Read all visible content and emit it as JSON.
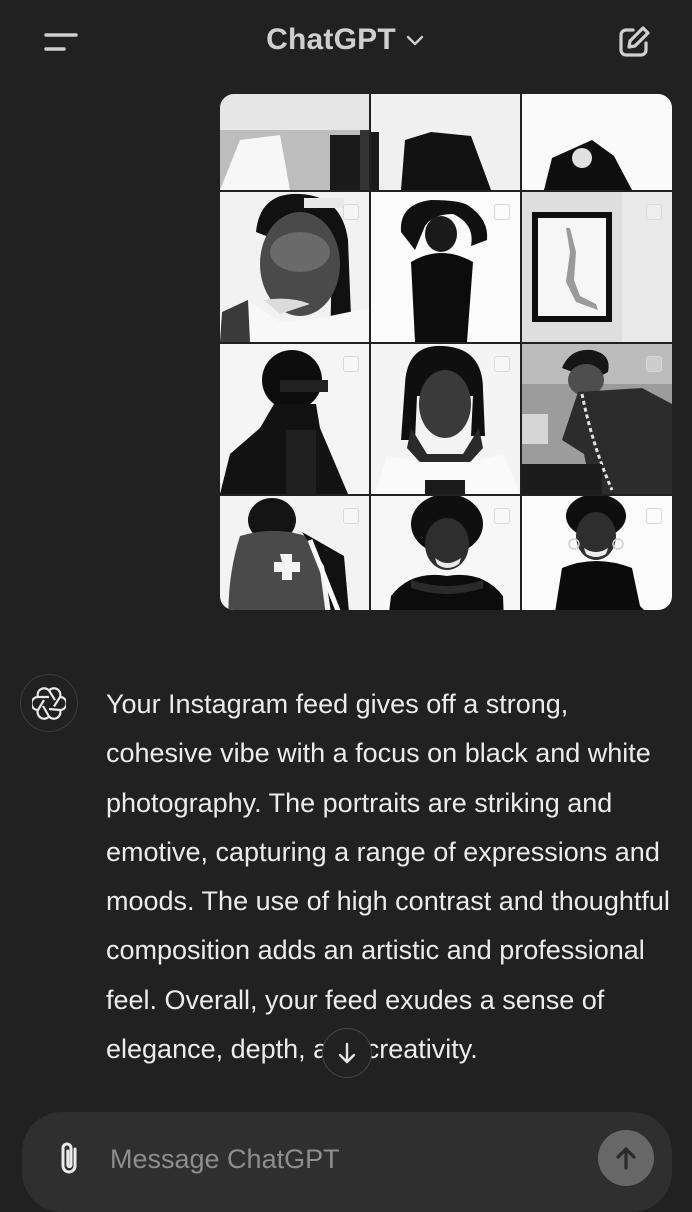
{
  "header": {
    "title": "ChatGPT",
    "menu_icon": "sidebar-menu-icon",
    "model_chevron_icon": "chevron-down-icon",
    "new_chat_icon": "new-chat-icon"
  },
  "image_attachment": {
    "style": "black-and-white Instagram grid screenshot",
    "columns": 3,
    "visible_rows": 5
  },
  "assistant_message": {
    "avatar_icon": "openai-logo-icon",
    "text": "Your Instagram feed gives off a strong, cohesive vibe with a focus on black and white photography. The portraits are striking and emotive, capturing a range of expressions and moods. The use of high contrast and thoughtful composition adds an artistic and professional feel. Overall, your feed exudes a sense of elegance, depth, and creativity."
  },
  "scroll_down_icon": "arrow-down-icon",
  "composer": {
    "placeholder": "Message ChatGPT",
    "value": "",
    "attach_icon": "paperclip-icon",
    "send_icon": "arrow-up-icon"
  },
  "colors": {
    "background": "#212121",
    "composer": "#2f2f2f",
    "text": "#ececec",
    "placeholder": "#8e8e8e",
    "send_button": "#676767"
  }
}
